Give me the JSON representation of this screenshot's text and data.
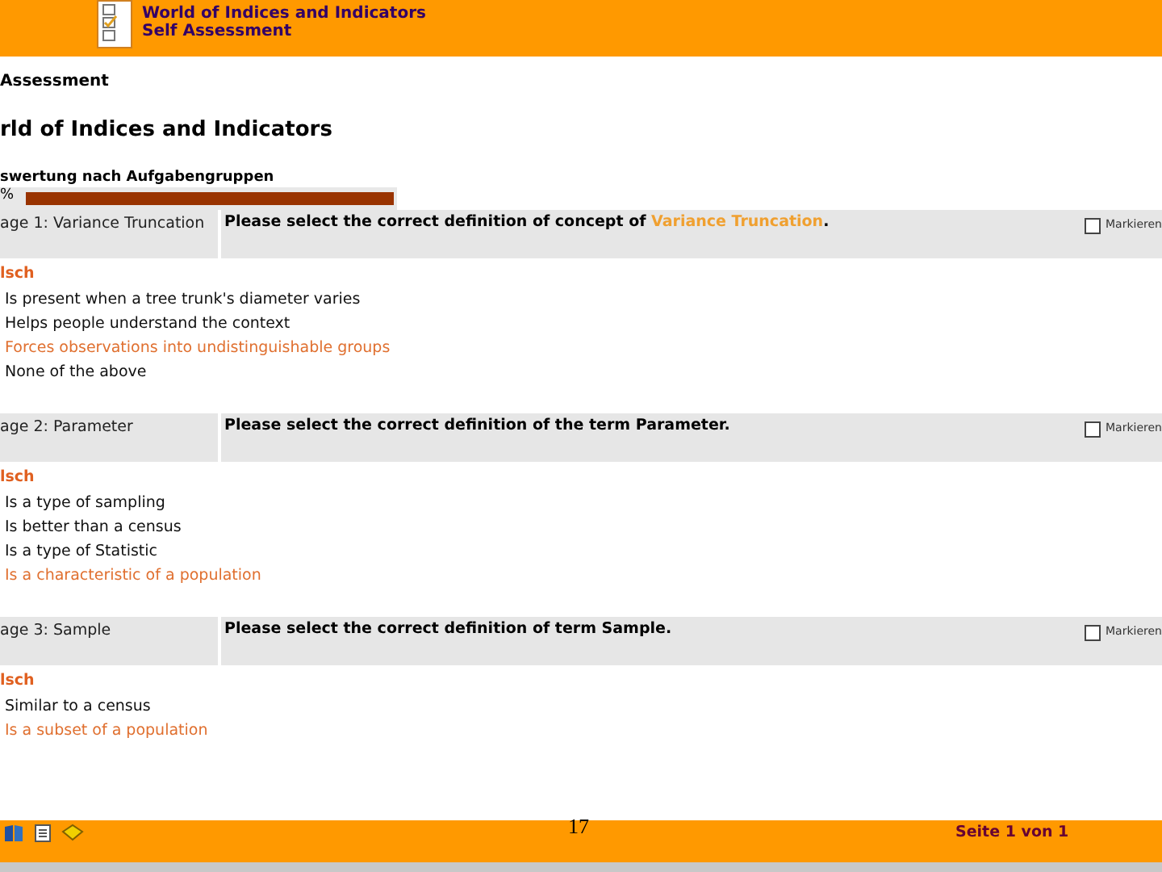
{
  "header": {
    "title": "World of Indices and Indicators",
    "subtitle": "Self Assessment"
  },
  "breadcrumb": "Assessment",
  "page_title": "rld of Indices and Indicators",
  "progress": {
    "label": "swertung nach Aufgabengruppen",
    "reading": "%",
    "level": 1
  },
  "questions": [
    {
      "label": "age 1: Variance Truncation",
      "parts": [
        {
          "text": "Please select the correct definition of concept of ",
          "highlighted": false
        },
        {
          "text": "Variance Truncation",
          "highlighted": true
        },
        {
          "text": ".",
          "highlighted": false
        }
      ],
      "mark_label": "Markieren",
      "checked": false,
      "result": "lsch",
      "answers": [
        {
          "text": "Is present when a tree trunk's diameter varies",
          "correct": false
        },
        {
          "text": "Helps people understand the context",
          "correct": false
        },
        {
          "text": "Forces observations into undistinguishable groups",
          "correct": true
        },
        {
          "text": "None of the above",
          "correct": false
        }
      ]
    },
    {
      "label": "age 2: Parameter",
      "parts": [
        {
          "text": "Please select the correct definition of the term Parameter.",
          "highlighted": false
        }
      ],
      "mark_label": "Markieren",
      "checked": false,
      "result": "lsch",
      "answers": [
        {
          "text": "Is a type of sampling",
          "correct": false
        },
        {
          "text": "Is better than a census",
          "correct": false
        },
        {
          "text": "Is a type of Statistic",
          "correct": false
        },
        {
          "text": "Is a characteristic of a population",
          "correct": true
        }
      ]
    },
    {
      "label": "age 3: Sample",
      "parts": [
        {
          "text": "Please select the correct definition of term Sample.",
          "highlighted": false
        }
      ],
      "mark_label": "Markieren",
      "checked": false,
      "result": "lsch",
      "answers": [
        {
          "text": "Similar to a census",
          "correct": false
        },
        {
          "text": "Is a subset of a population",
          "correct": true
        }
      ]
    }
  ],
  "footer": {
    "slide_number": "17",
    "page_info": "Seite 1 von 1"
  }
}
